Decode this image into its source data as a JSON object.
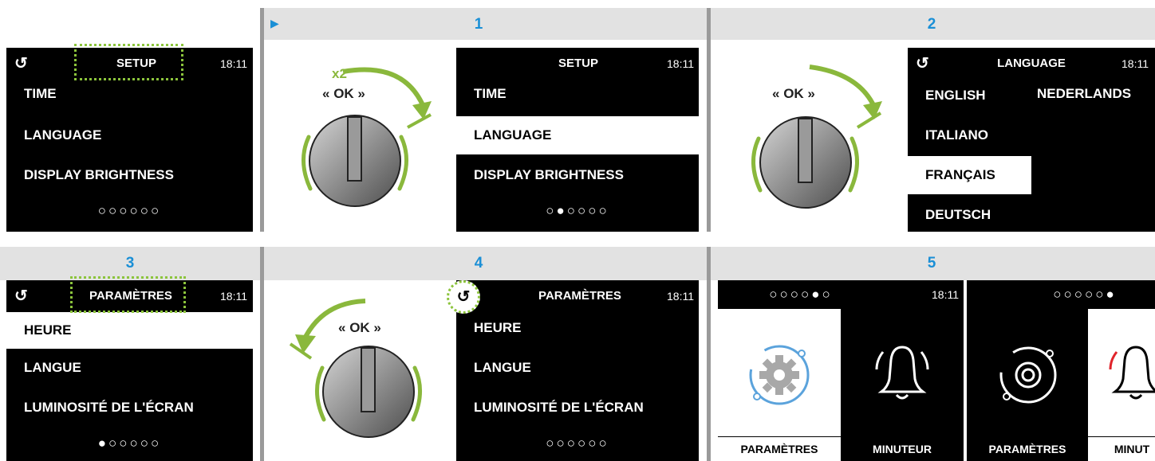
{
  "panel0": {
    "title": "SETUP",
    "time": "18:11",
    "back": "↺",
    "items": [
      "TIME",
      "LANGUAGE",
      "DISPLAY BRIGHTNESS"
    ],
    "dots": "○○○○○○"
  },
  "panel1": {
    "step": "1",
    "play": "▶",
    "knob": {
      "ok": "OK",
      "x2": "x2"
    },
    "title": "SETUP",
    "time": "18:11",
    "items": [
      "TIME",
      "LANGUAGE",
      "DISPLAY BRIGHTNESS"
    ],
    "dots": "○●○○○○"
  },
  "panel2": {
    "step": "2",
    "knob": {
      "ok": "OK"
    },
    "title": "LANGUAGE",
    "time": "18:11",
    "back": "↺",
    "languages": [
      "ENGLISH",
      "NEDERLANDS",
      "ITALIANO",
      "FRANÇAIS",
      "DEUTSCH"
    ]
  },
  "panel3": {
    "step": "3",
    "title": "PARAMÈTRES",
    "time": "18:11",
    "back": "↺",
    "items": [
      "HEURE",
      "LANGUE",
      "LUMINOSITÉ DE L'ÉCRAN"
    ],
    "dots": "●○○○○○"
  },
  "panel4": {
    "step": "4",
    "knob": {
      "ok": "OK"
    },
    "title": "PARAMÈTRES",
    "time": "18:11",
    "back": "↺",
    "items": [
      "HEURE",
      "LANGUE",
      "LUMINOSITÉ DE L'ÉCRAN"
    ],
    "dots": "○○○○○○"
  },
  "panel5": {
    "step": "5",
    "screenA": {
      "dots": "○○○○●○",
      "time": "18:11",
      "tiles": [
        "PARAMÈTRES",
        "MINUTEUR"
      ]
    },
    "screenB": {
      "dots": "○○○○○●",
      "tiles": [
        "PARAMÈTRES",
        "MINUT"
      ]
    }
  },
  "colors": {
    "accent_green": "#8cc43c",
    "step_blue": "#1a8fd6",
    "settings_blue": "#5ba3dc",
    "bell_red": "#e0242b"
  }
}
